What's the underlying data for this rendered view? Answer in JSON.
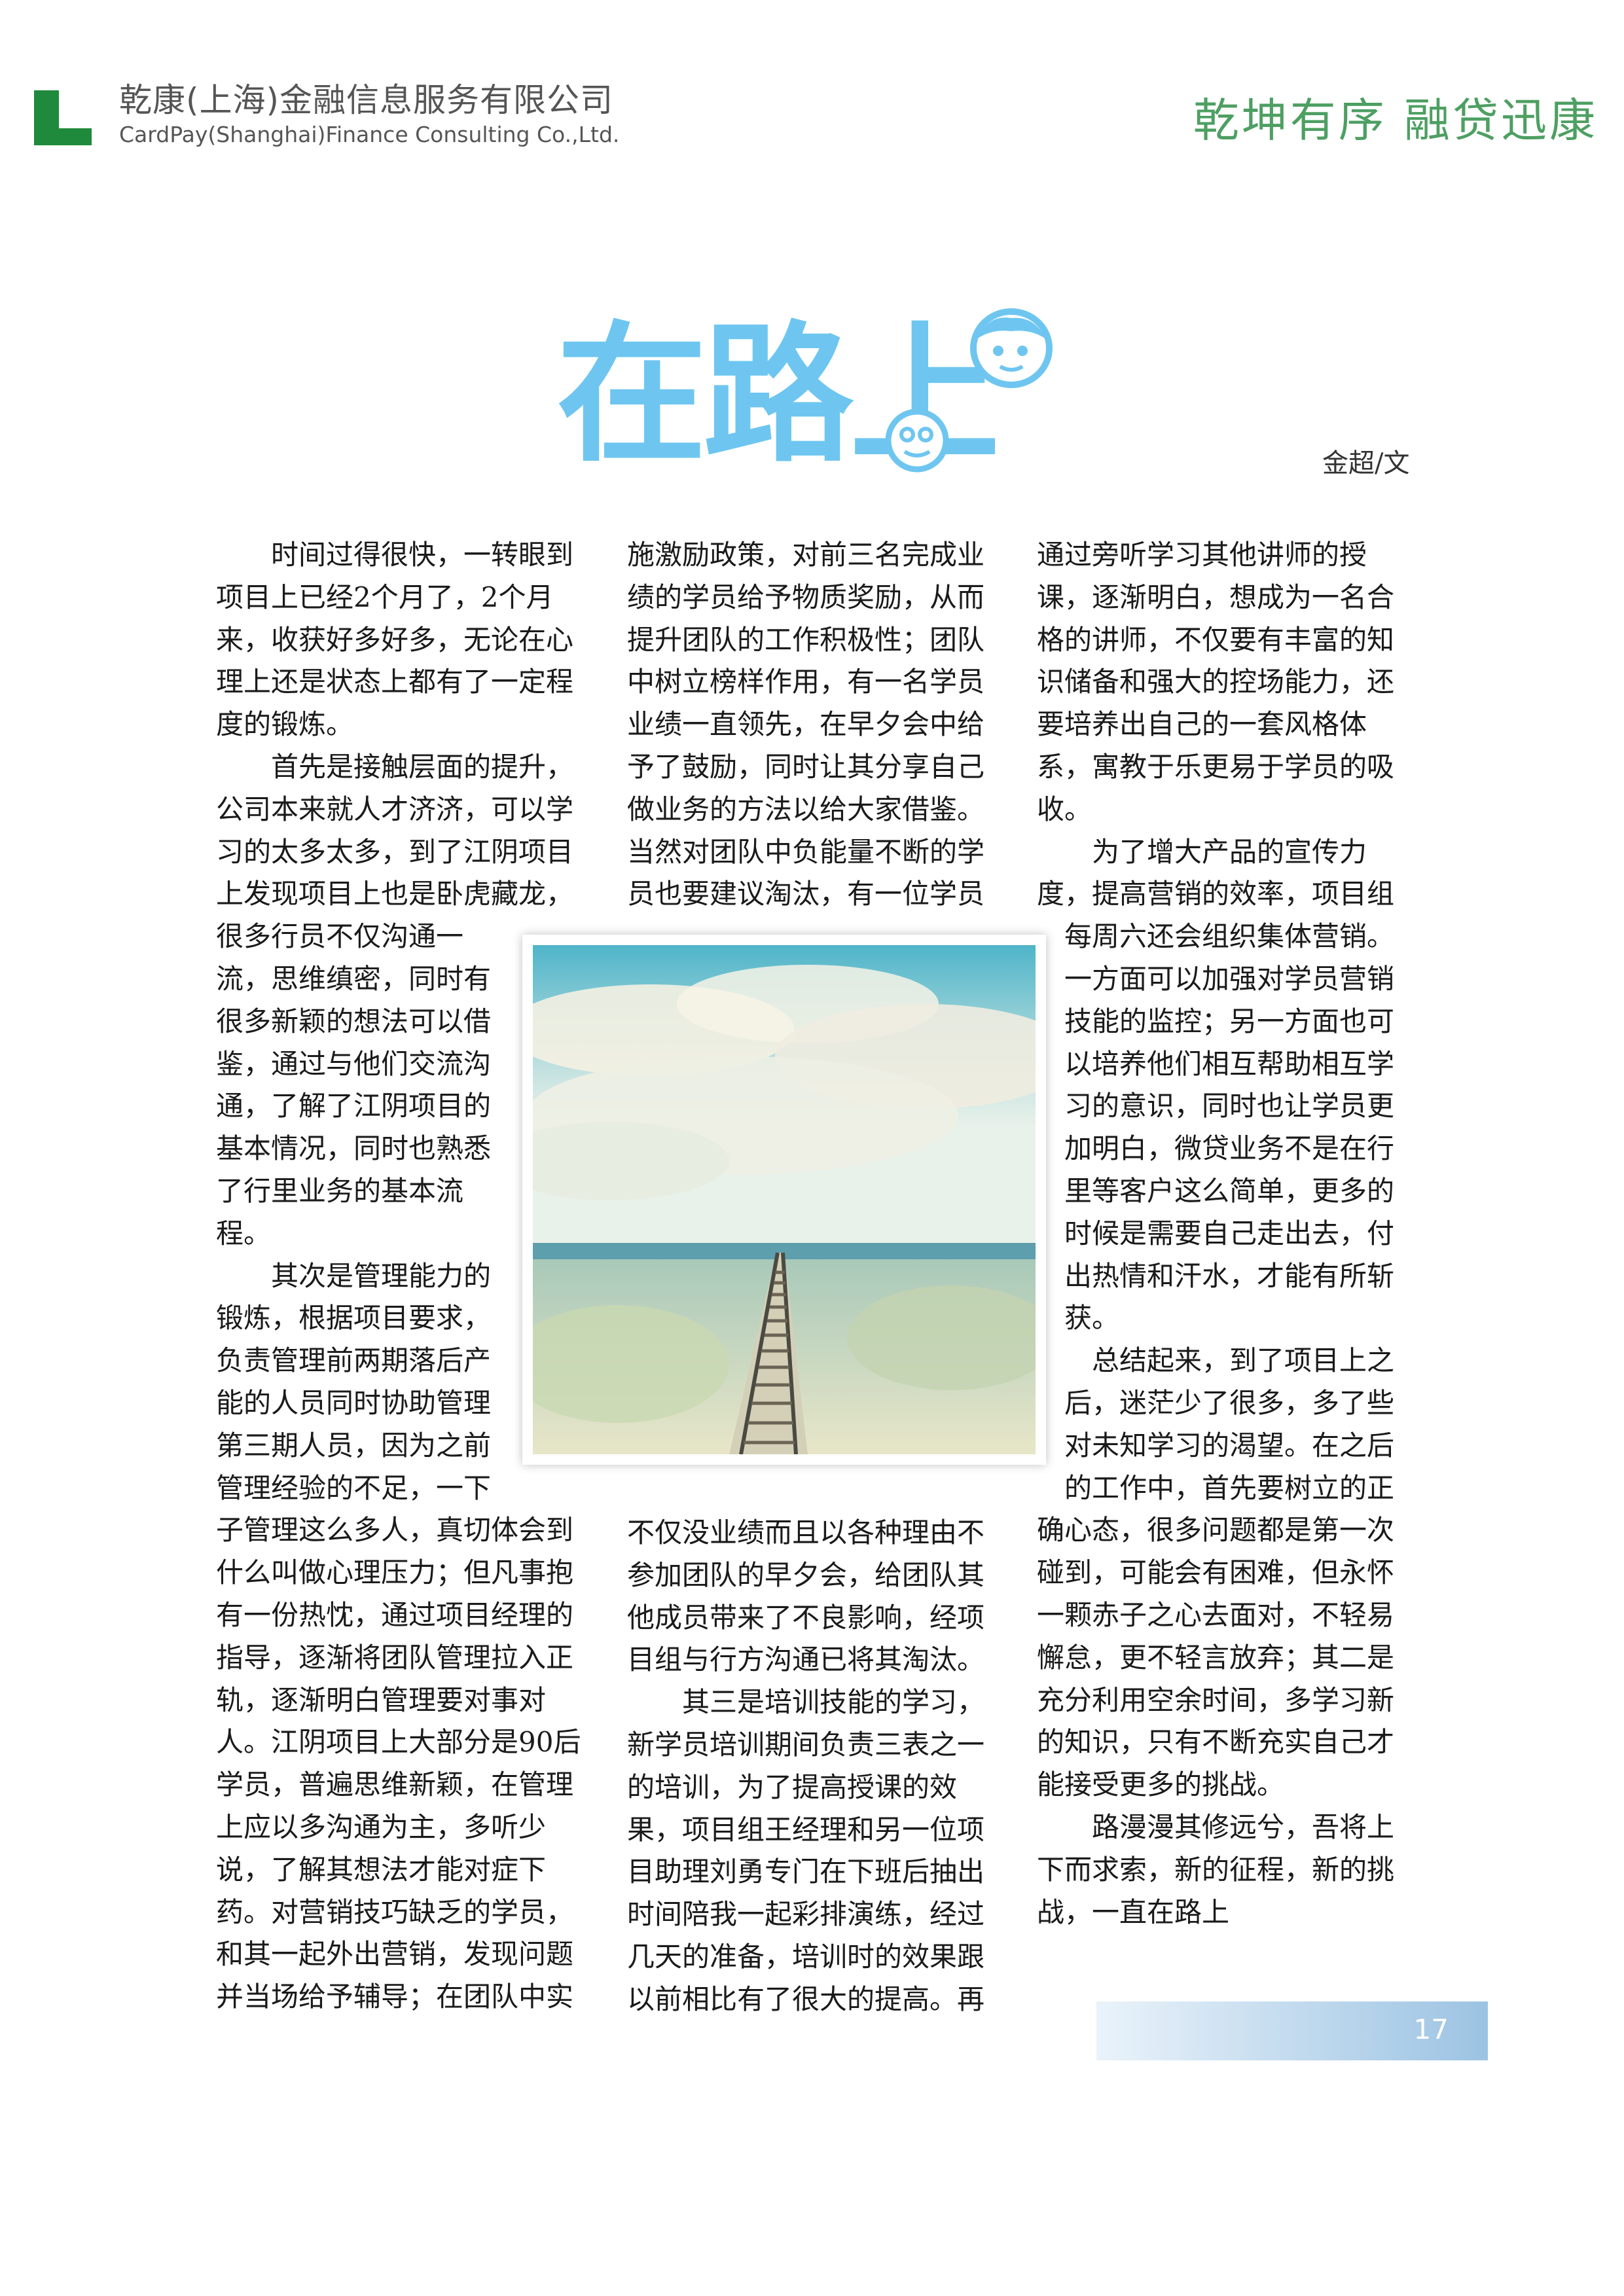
{
  "header": {
    "company_cn": "乾康(上海)金融信息服务有限公司",
    "company_en": "CardPay(Shanghai)Finance Consulting Co.,Ltd.",
    "slogan": "乾坤有序 融贷迅康",
    "logo_icon": "company-logo-icon",
    "brand_color": "#2f8f47"
  },
  "article": {
    "title": "在路上",
    "title_color": "#6ec6f0",
    "byline": "金超/文",
    "image": "railway-track-landscape-photo",
    "columns": [
      [
        "　　时间过得很快，一转眼到",
        "项目上已经2个月了，2个月",
        "来，收获好多好多，无论在心",
        "理上还是状态上都有了一定程",
        "度的锻炼。",
        "　　首先是接触层面的提升，",
        "公司本来就人才济济，可以学",
        "习的太多太多，到了江阴项目",
        "上发现项目上也是卧虎藏龙，",
        "很多行员不仅沟通一",
        "流，思维缜密，同时有",
        "很多新颖的想法可以借",
        "鉴，通过与他们交流沟",
        "通，了解了江阴项目的",
        "基本情况，同时也熟悉",
        "了行里业务的基本流",
        "程。",
        "　　其次是管理能力的",
        "锻炼，根据项目要求，",
        "负责管理前两期落后产",
        "能的人员同时协助管理",
        "第三期人员，因为之前",
        "管理经验的不足，一下",
        "子管理这么多人，真切体会到",
        "什么叫做心理压力；但凡事抱",
        "有一份热忱，通过项目经理的",
        "指导，逐渐将团队管理拉入正",
        "轨，逐渐明白管理要对事对",
        "人。江阴项目上大部分是90后",
        "学员，普遍思维新颖，在管理",
        "上应以多沟通为主，多听少",
        "说，了解其想法才能对症下",
        "药。对营销技巧缺乏的学员，",
        "和其一起外出营销，发现问题",
        "并当场给予辅导；在团队中实"
      ],
      [
        "施激励政策，对前三名完成业",
        "绩的学员给予物质奖励，从而",
        "提升团队的工作积极性；团队",
        "中树立榜样作用，有一名学员",
        "业绩一直领先，在早夕会中给",
        "予了鼓励，同时让其分享自己",
        "做业务的方法以给大家借鉴。",
        "当然对团队中负能量不断的学",
        "员也要建议淘汰，有一位学员"
      ],
      [
        "不仅没业绩而且以各种理由不",
        "参加团队的早夕会，给团队其",
        "他成员带来了不良影响，经项",
        "目组与行方沟通已将其淘汰。",
        "　　其三是培训技能的学习，",
        "新学员培训期间负责三表之一",
        "的培训，为了提高授课的效",
        "果，项目组王经理和另一位项",
        "目助理刘勇专门在下班后抽出",
        "时间陪我一起彩排演练，经过",
        "几天的准备，培训时的效果跟",
        "以前相比有了很大的提高。再"
      ],
      [
        "通过旁听学习其他讲师的授",
        "课，逐渐明白，想成为一名合",
        "格的讲师，不仅要有丰富的知",
        "识储备和强大的控场能力，还",
        "要培养出自己的一套风格体",
        "系，寓教于乐更易于学员的吸",
        "收。",
        "　　为了增大产品的宣传力",
        "度，提高营销的效率，项目组",
        "　每周六还会组织集体营销。",
        "　一方面可以加强对学员营销",
        "　技能的监控；另一方面也可",
        "　以培养他们相互帮助相互学",
        "　习的意识，同时也让学员更",
        "　加明白，微贷业务不是在行",
        "　里等客户这么简单，更多的",
        "　时候是需要自己走出去，付",
        "　出热情和汗水，才能有所斩",
        "　获。",
        "　　总结起来，到了项目上之",
        "　后，迷茫少了很多，多了些",
        "　对未知学习的渴望。在之后",
        "　的工作中，首先要树立的正",
        "确心态，很多问题都是第一次",
        "碰到，可能会有困难，但永怀",
        "一颗赤子之心去面对，不轻易",
        "懈怠，更不轻言放弃；其二是",
        "充分利用空余时间，多学习新",
        "的知识，只有不断充实自己才",
        "能接受更多的挑战。",
        "　　路漫漫其修远兮，吾将上",
        "下而求索，新的征程，新的挑",
        "战，一直在路上"
      ]
    ]
  },
  "footer": {
    "page_number": "17"
  }
}
